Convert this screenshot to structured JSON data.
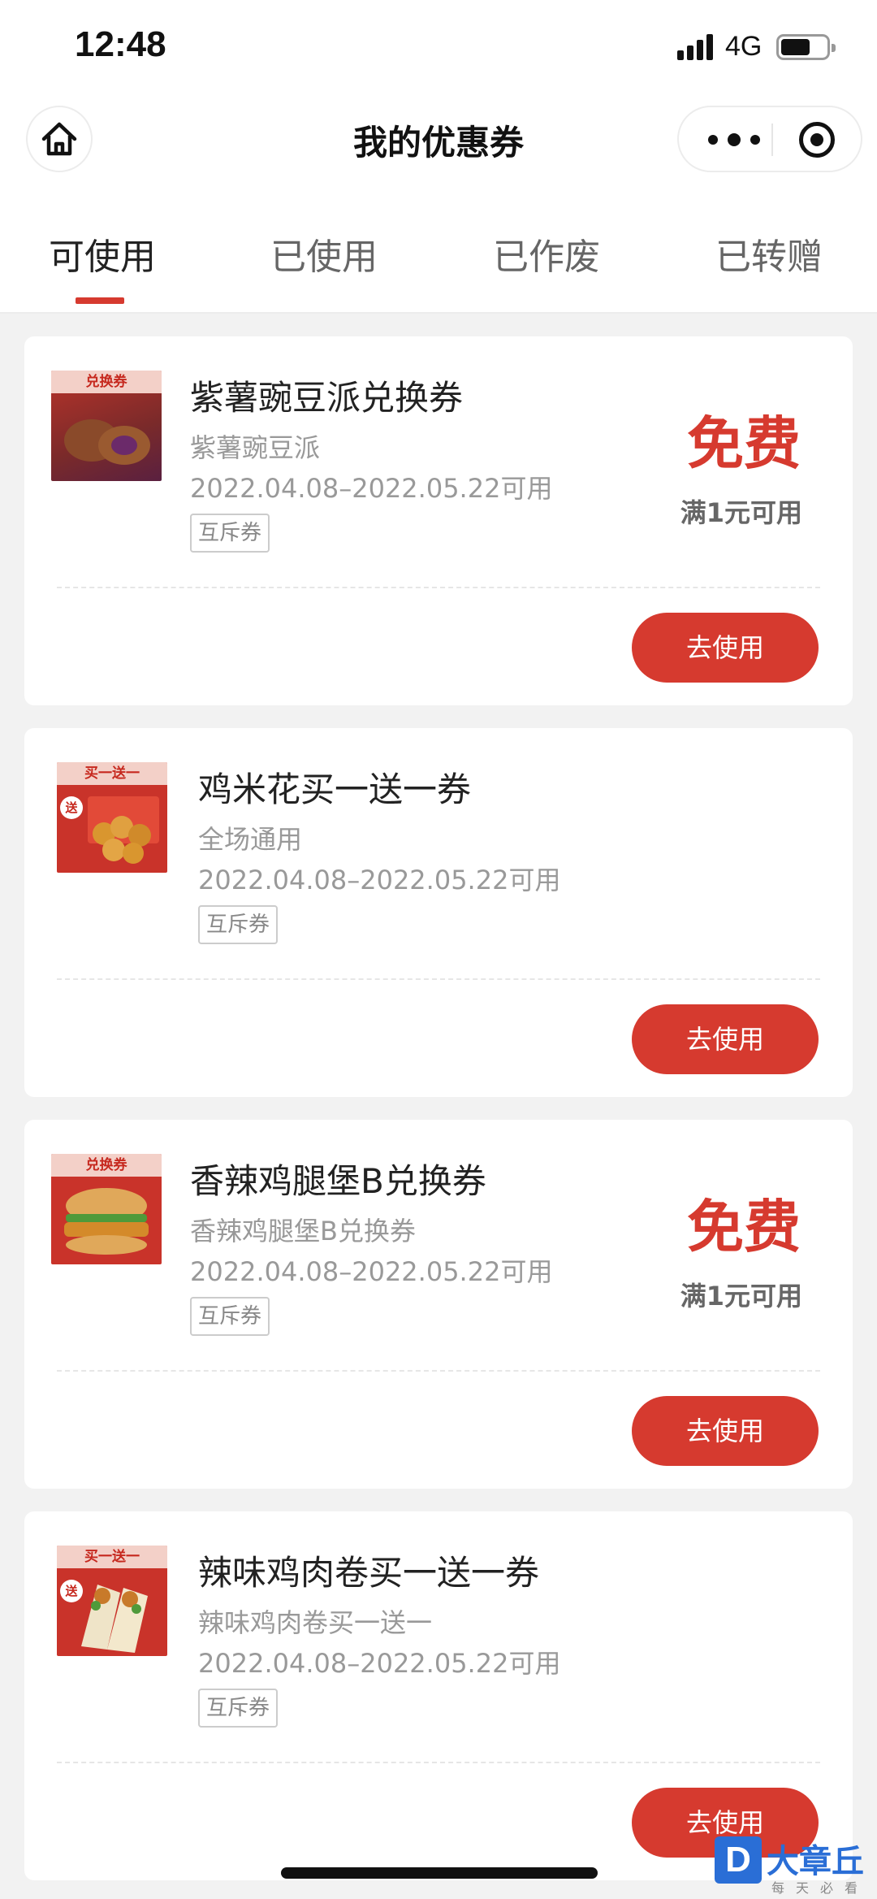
{
  "status_bar": {
    "time": "12:48",
    "network": "4G",
    "battery_level": 0.65
  },
  "nav": {
    "title": "我的优惠券",
    "home_icon": "home-icon",
    "more_icon": "more-dots-icon",
    "target_icon": "target-icon"
  },
  "tabs": [
    {
      "label": "可使用",
      "active": true
    },
    {
      "label": "已使用",
      "active": false
    },
    {
      "label": "已作废",
      "active": false
    },
    {
      "label": "已转赠",
      "active": false
    }
  ],
  "coupons": [
    {
      "title": "紫薯豌豆派兑换券",
      "subtitle": "紫薯豌豆派",
      "date_range": "2022.04.08–2022.05.22可用",
      "tag": "互斥券",
      "price": "免费",
      "condition": "满1元可用",
      "button": "去使用",
      "thumb_ribbon": "兑换券",
      "thumb_gift": ""
    },
    {
      "title": "鸡米花买一送一券",
      "subtitle": "全场通用",
      "date_range": "2022.04.08–2022.05.22可用",
      "tag": "互斥券",
      "price": "",
      "condition": "",
      "button": "去使用",
      "thumb_ribbon": "买一送一",
      "thumb_gift": "送"
    },
    {
      "title": "香辣鸡腿堡B兑换券",
      "subtitle": "香辣鸡腿堡B兑换券",
      "date_range": "2022.04.08–2022.05.22可用",
      "tag": "互斥券",
      "price": "免费",
      "condition": "满1元可用",
      "button": "去使用",
      "thumb_ribbon": "兑换券",
      "thumb_gift": ""
    },
    {
      "title": "辣味鸡肉卷买一送一券",
      "subtitle": "辣味鸡肉卷买一送一",
      "date_range": "2022.04.08–2022.05.22可用",
      "tag": "互斥券",
      "price": "",
      "condition": "",
      "button": "去使用",
      "thumb_ribbon": "买一送一",
      "thumb_gift": "送"
    }
  ],
  "watermark": {
    "logo": "D",
    "name": "大章丘",
    "slogan": "每天必看"
  },
  "colors": {
    "accent": "#d63a2f",
    "background": "#f2f2f2",
    "watermark": "#2a6ed6"
  }
}
